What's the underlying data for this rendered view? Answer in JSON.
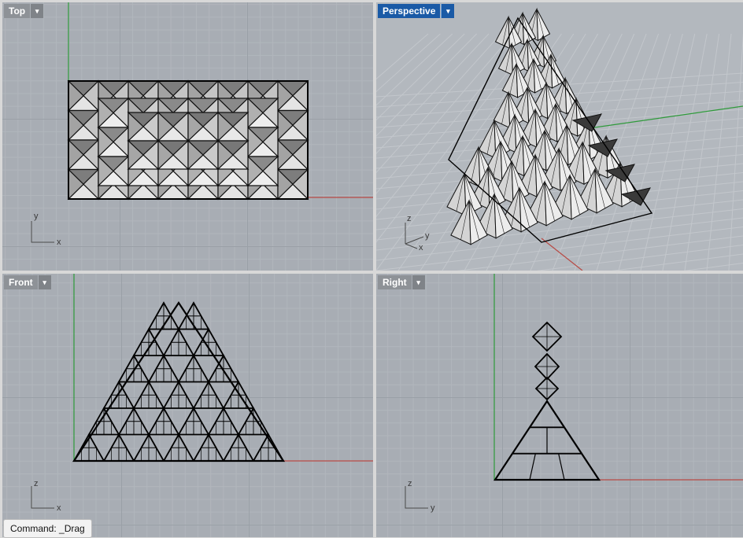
{
  "viewports": {
    "top": {
      "label": "Top",
      "menu_icon": "chevron-down-icon"
    },
    "perspective": {
      "label": "Perspective",
      "menu_icon": "chevron-down-icon",
      "active": true
    },
    "front": {
      "label": "Front",
      "menu_icon": "chevron-down-icon"
    },
    "right": {
      "label": "Right",
      "menu_icon": "chevron-down-icon"
    }
  },
  "axes": {
    "top": {
      "v": "y",
      "h": "x"
    },
    "perspective": {
      "v": "z",
      "a": "y",
      "b": "x"
    },
    "front": {
      "v": "z",
      "h": "x"
    },
    "right": {
      "v": "z",
      "h": "y"
    }
  },
  "colors": {
    "x_axis": "#b84a44",
    "y_axis": "#2e9a3a",
    "active_tab": "#1a5aa6"
  },
  "command": {
    "text": "Command: _Drag"
  },
  "menu_glyph": "▾"
}
